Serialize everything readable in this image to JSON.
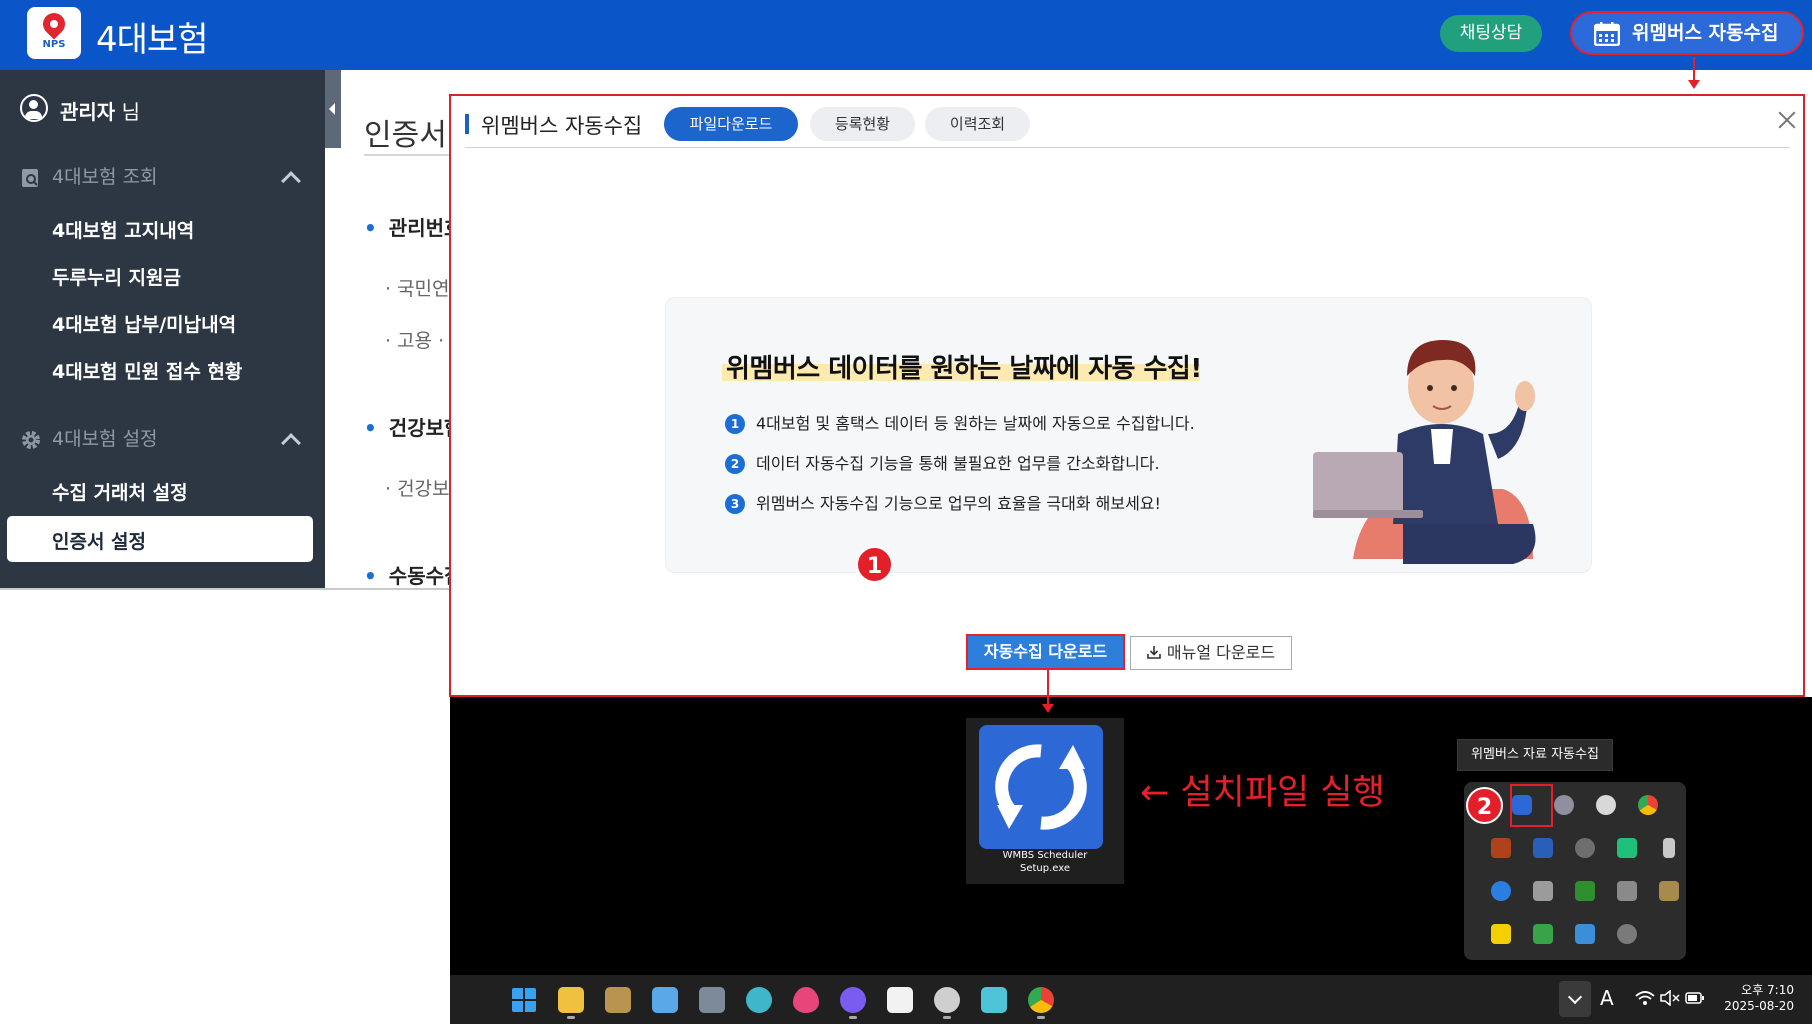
{
  "header": {
    "app_title": "4대보험",
    "logo_text": "NPS",
    "chat_label": "채팅상담",
    "collect_label": "위멤버스 자동수집",
    "brand_color": "#0a55c8"
  },
  "sidebar": {
    "user_name": "관리자",
    "user_suffix": "님",
    "group1_label": "4대보험 조회",
    "group1_items": [
      "4대보험 고지내역",
      "두루누리 지원금",
      "4대보험 납부/미납내역",
      "4대보험 민원 접수 현황"
    ],
    "group2_label": "4대보험 설정",
    "group2_items": [
      "수집 거래처 설정",
      "인증서 설정"
    ],
    "active_item": "인증서 설정"
  },
  "background_page": {
    "title": "인증서",
    "sections": [
      "관리번호",
      "건강보험",
      "수동수집"
    ],
    "subitems": [
      "· 국민연",
      "· 고용 ·",
      "· 건강보"
    ]
  },
  "modal": {
    "title": "위멤버스 자동수집",
    "tabs": [
      "파일다운로드",
      "등록현황",
      "이력조회"
    ],
    "active_tab": "파일다운로드",
    "promo_heading": "위멤버스 데이터를 원하는 날짜에 자동 수집!",
    "promo_points": [
      "4대보험 및 홈택스 데이터 등 원하는 날짜에 자동으로 수집합니다.",
      "데이터 자동수집 기능을 통해 불필요한 업무를 간소화합니다.",
      "위멤버스 자동수집 기능으로 업무의 효율을 극대화 해보세요!"
    ],
    "download_button": "자동수집 다운로드",
    "manual_button": "매뉴얼 다운로드"
  },
  "annotations": {
    "step1": "1",
    "step2": "2",
    "run_installer": "← 설치파일 실행",
    "accent_color": "#e3202a"
  },
  "desktop": {
    "setup_file_name_line1": "WMBS Scheduler",
    "setup_file_name_line2": "Setup.exe",
    "tray_tooltip": "위멤버스 자료 자동수집",
    "tray_icons": [
      "wembers-sync-icon",
      "chat-bubble-icon",
      "gear-icon",
      "chrome-icon",
      "office-icon",
      "c-app-icon",
      "link-icon",
      "kinesis-icon",
      "usb-icon",
      "bluetooth-icon",
      "folder-icon",
      "nvidia-icon",
      "display-icon",
      "crop-icon",
      "kakaotalk-icon",
      "network-icon",
      "shield-icon",
      "cloud-off-icon"
    ]
  },
  "taskbar": {
    "icons": [
      "windows-start-icon",
      "file-explorer-icon",
      "crop-tool-icon",
      "notepad-icon",
      "calculator-icon",
      "paint-icon",
      "drop-icon",
      "messenger-icon",
      "notion-icon",
      "apple-icon",
      "bird-icon",
      "chrome-icon"
    ],
    "language": "A",
    "time": "오후 7:10",
    "date": "2025-08-20"
  }
}
